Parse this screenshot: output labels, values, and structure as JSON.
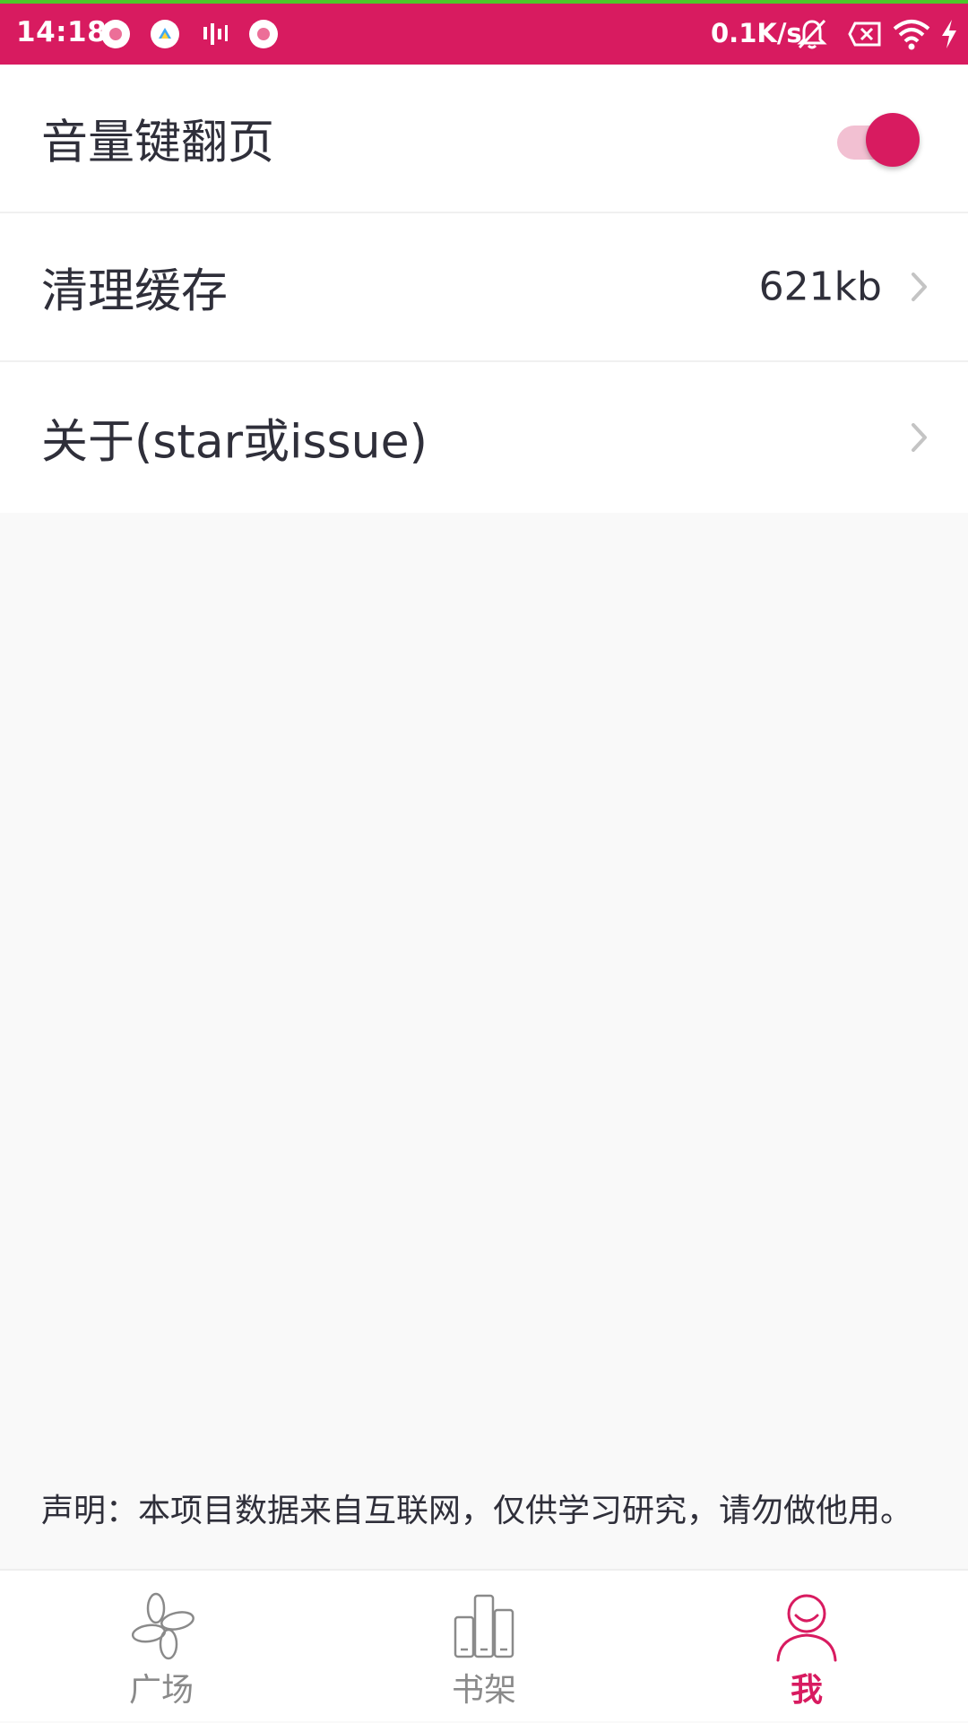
{
  "status_bar": {
    "time": "14:18",
    "net_speed": "0.1K/s",
    "icons": [
      "notification-dot-icon",
      "app-icon",
      "sound-bars-icon",
      "notification-dot-icon",
      "bell-off-icon",
      "sim-off-icon",
      "wifi-icon",
      "charging-icon"
    ],
    "background": "#d81b60"
  },
  "settings": {
    "volume_page_turn": {
      "label": "音量键翻页",
      "enabled": true
    },
    "clear_cache": {
      "label": "清理缓存",
      "value": "621kb"
    },
    "about": {
      "label": "关于(star或issue)"
    }
  },
  "disclaimer": "声明：本项目数据来自互联网，仅供学习研究，请勿做他用。",
  "bottom_nav": {
    "items": [
      {
        "label": "广场",
        "icon": "plaza-icon",
        "active": false
      },
      {
        "label": "书架",
        "icon": "bookshelf-icon",
        "active": false
      },
      {
        "label": "我",
        "icon": "user-icon",
        "active": true
      }
    ]
  },
  "colors": {
    "accent": "#d81b60",
    "text": "#2f2f3a",
    "inactive": "#8a8a8a"
  }
}
